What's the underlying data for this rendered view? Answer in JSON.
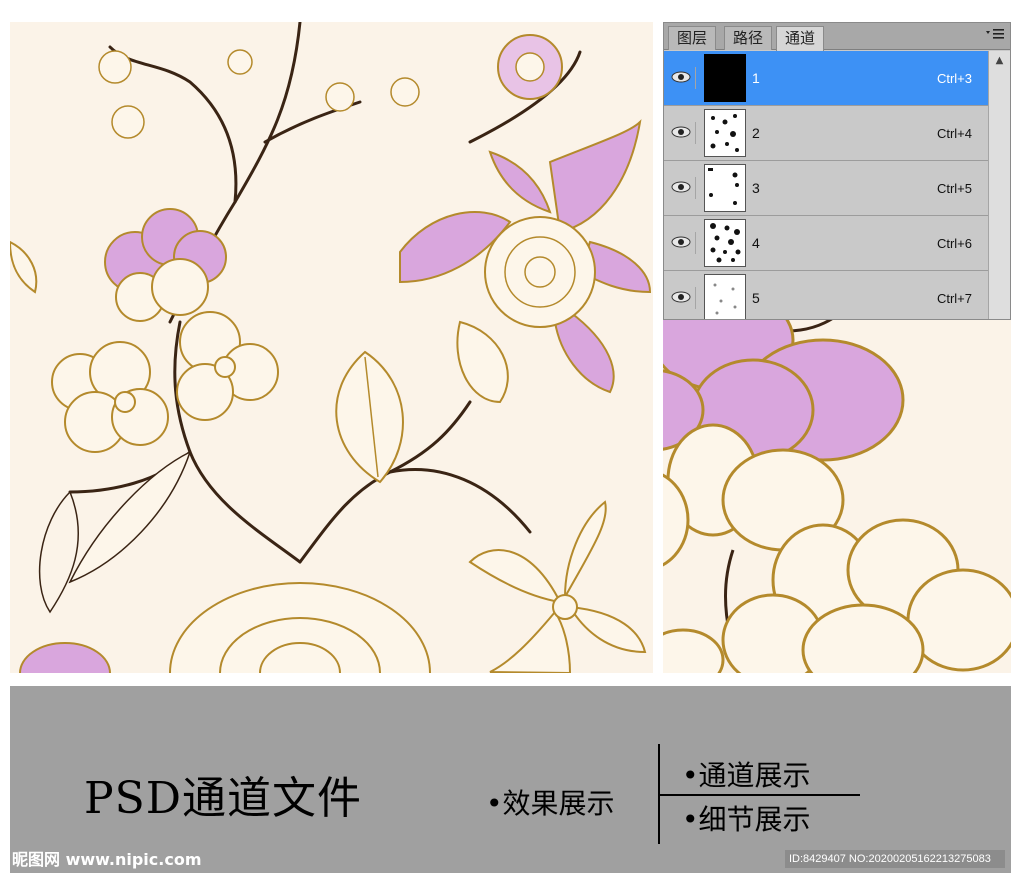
{
  "panel": {
    "tabs": [
      {
        "label": "图层",
        "active": false
      },
      {
        "label": "路径",
        "active": false
      },
      {
        "label": "通道",
        "active": true
      }
    ],
    "menu_icon": "panel-menu-icon",
    "channels": [
      {
        "name": "1",
        "shortcut": "Ctrl+3",
        "selected": true
      },
      {
        "name": "2",
        "shortcut": "Ctrl+4",
        "selected": false
      },
      {
        "name": "3",
        "shortcut": "Ctrl+5",
        "selected": false
      },
      {
        "name": "4",
        "shortcut": "Ctrl+6",
        "selected": false
      },
      {
        "name": "5",
        "shortcut": "Ctrl+7",
        "selected": false
      }
    ]
  },
  "banner": {
    "title": "PSD通道文件",
    "effect_label": "•效果展示",
    "channels_label": "•通道展示",
    "detail_label": "•细节展示"
  },
  "watermark": {
    "site": "昵图网 www.nipic.com",
    "id_text": "ID:8429407 NO:20200205162213275083"
  },
  "colors": {
    "background": "#fbf3e8",
    "petal_pink": "#d9a6dd",
    "outline_gold": "#b48a2c",
    "stem_brown": "#3a2414",
    "selection_blue": "#3d91f5",
    "banner_gray": "#a0a0a0"
  }
}
